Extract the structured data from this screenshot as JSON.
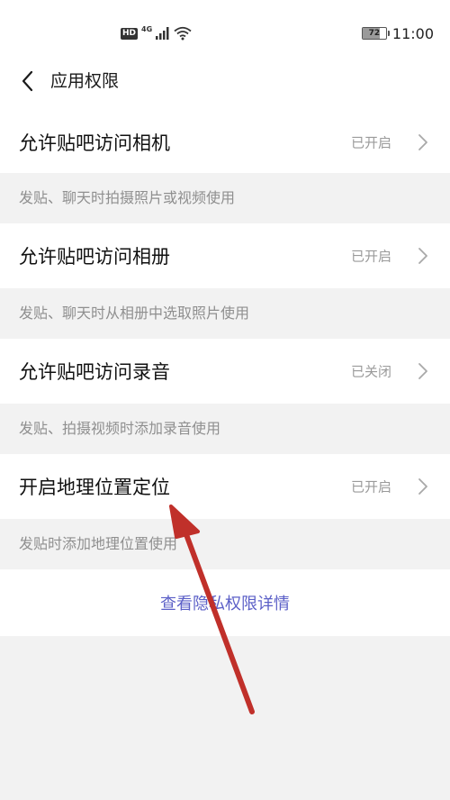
{
  "status_bar": {
    "hd_label": "HD",
    "network_label": "4G",
    "battery_level": "72",
    "battery_fraction": 0.72,
    "time": "11:00",
    "icons": [
      "signal-icon",
      "wifi-icon",
      "battery-icon"
    ]
  },
  "header": {
    "back_icon": "chevron-left-icon",
    "title": "应用权限"
  },
  "permissions": [
    {
      "title": "允许贴吧访问相机",
      "status": "已开启",
      "description": "发贴、聊天时拍摄照片或视频使用"
    },
    {
      "title": "允许贴吧访问相册",
      "status": "已开启",
      "description": "发贴、聊天时从相册中选取照片使用"
    },
    {
      "title": "允许贴吧访问录音",
      "status": "已关闭",
      "description": "发贴、拍摄视频时添加录音使用"
    },
    {
      "title": "开启地理位置定位",
      "status": "已开启",
      "description": "发贴时添加地理位置使用"
    }
  ],
  "privacy_link": "查看隐私权限详情",
  "colors": {
    "link": "#5b5fc7",
    "annotation_arrow": "#c0302a",
    "background": "#f2f2f2",
    "status_text": "#9a9a9a"
  }
}
